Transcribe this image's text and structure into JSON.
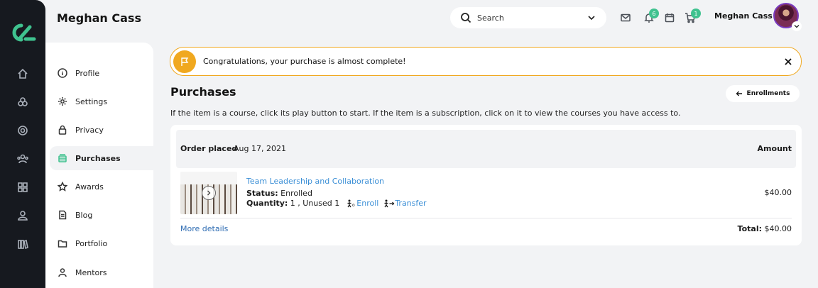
{
  "header": {
    "page_user": "Meghan Cass",
    "search_placeholder": "Search",
    "notification_count": "6",
    "cart_count": "1",
    "user_name": "Meghan Cass"
  },
  "rail": {
    "icons": [
      "home-icon",
      "courses-icon",
      "compass-icon",
      "community-icon",
      "apps-icon",
      "user-icon",
      "library-icon"
    ]
  },
  "sidebar": {
    "items": [
      {
        "label": "Profile",
        "icon": "info-icon"
      },
      {
        "label": "Settings",
        "icon": "gear-icon"
      },
      {
        "label": "Privacy",
        "icon": "lock-icon"
      },
      {
        "label": "Purchases",
        "icon": "purchases-icon",
        "active": true
      },
      {
        "label": "Awards",
        "icon": "star-icon"
      },
      {
        "label": "Blog",
        "icon": "document-icon"
      },
      {
        "label": "Portfolio",
        "icon": "folder-icon"
      },
      {
        "label": "Mentors",
        "icon": "mentors-icon"
      }
    ]
  },
  "alert": {
    "message": "Congratulations, your purchase is almost complete!"
  },
  "main": {
    "title": "Purchases",
    "back_button": "Enrollments",
    "description": "If the item is a course, click its play button to start. If the item is a subscription, click on it to view the courses you have access to."
  },
  "order": {
    "placed_label": "Order placed",
    "placed_date": "Aug 17, 2021",
    "amount_label": "Amount",
    "item": {
      "title": "Team Leadership and Collaboration",
      "status_label": "Status:",
      "status_value": "Enrolled",
      "quantity_label": "Quantity:",
      "quantity_value": "1 , Unused 1",
      "enroll_label": "Enroll",
      "transfer_label": "Transfer",
      "price": "$40.00"
    },
    "more_details": "More details",
    "total_label": "Total:",
    "total_value": "$40.00"
  },
  "colors": {
    "accent_green": "#3fc28f",
    "alert_orange": "#f0a81f",
    "link_blue": "#3b8fd6",
    "rail_bg": "#16191f"
  }
}
